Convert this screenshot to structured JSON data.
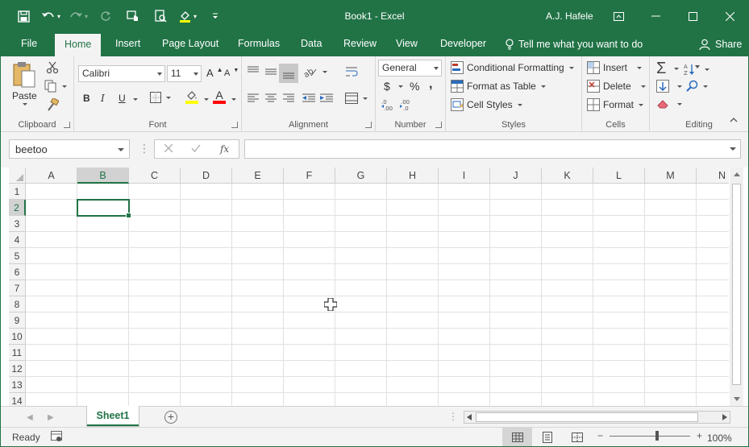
{
  "window": {
    "title": "Book1  -  Excel",
    "user": "A.J. Hafele"
  },
  "tabs": [
    "File",
    "Home",
    "Insert",
    "Page Layout",
    "Formulas",
    "Data",
    "Review",
    "View",
    "Developer"
  ],
  "active_tab": "Home",
  "tell_me": "Tell me what you want to do",
  "share": "Share",
  "ribbon": {
    "clipboard": {
      "label": "Clipboard",
      "paste": "Paste"
    },
    "font": {
      "label": "Font",
      "name": "Calibri",
      "size": "11",
      "bold": "B",
      "italic": "I",
      "underline": "U",
      "font_color_letter": "A",
      "fill_color": "#ffff00",
      "font_color": "#ff0000"
    },
    "alignment": {
      "label": "Alignment"
    },
    "number": {
      "label": "Number",
      "format": "General",
      "currency": "$",
      "percent": "%",
      "comma": ","
    },
    "styles": {
      "label": "Styles",
      "conditional": "Conditional Formatting",
      "format_table": "Format as Table",
      "cell_styles": "Cell Styles"
    },
    "cells": {
      "label": "Cells",
      "insert": "Insert",
      "delete": "Delete",
      "format": "Format"
    },
    "editing": {
      "label": "Editing"
    }
  },
  "formula_bar": {
    "name_box": "beetoo",
    "fx": "fx",
    "formula": ""
  },
  "grid": {
    "columns": [
      "A",
      "B",
      "C",
      "D",
      "E",
      "F",
      "G",
      "H",
      "I",
      "J",
      "K",
      "L",
      "M",
      "N"
    ],
    "rows": [
      "1",
      "2",
      "3",
      "4",
      "5",
      "6",
      "7",
      "8",
      "9",
      "10",
      "11",
      "12",
      "13",
      "14"
    ],
    "selected_column": "B",
    "selected_row": "2"
  },
  "sheets": [
    "Sheet1"
  ],
  "status": {
    "ready": "Ready",
    "zoom": "100%"
  },
  "colors": {
    "accent": "#217346"
  }
}
